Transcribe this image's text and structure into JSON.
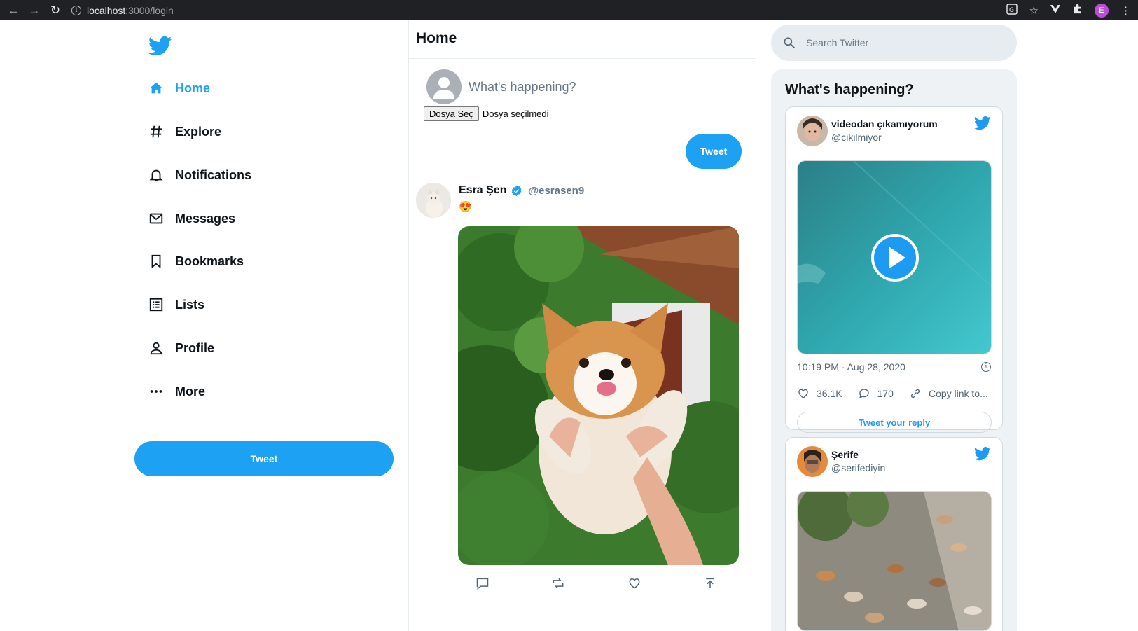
{
  "browser": {
    "url_host": "localhost",
    "url_path": ":3000/login",
    "profile_initial": "E"
  },
  "nav": {
    "items": [
      {
        "label": "Home",
        "icon": "home-icon"
      },
      {
        "label": "Explore",
        "icon": "hashtag-icon"
      },
      {
        "label": "Notifications",
        "icon": "bell-icon"
      },
      {
        "label": "Messages",
        "icon": "mail-icon"
      },
      {
        "label": "Bookmarks",
        "icon": "bookmark-icon"
      },
      {
        "label": "Lists",
        "icon": "list-icon"
      },
      {
        "label": "Profile",
        "icon": "user-icon"
      },
      {
        "label": "More",
        "icon": "more-icon"
      }
    ],
    "tweet_button": "Tweet"
  },
  "feed": {
    "title": "Home",
    "compose_placeholder": "What's happening?",
    "file_button": "Dosya Seç",
    "file_status": "Dosya seçilmedi",
    "tweet_button": "Tweet",
    "post": {
      "name": "Esra Şen",
      "handle": "@esrasen9",
      "text": "😍"
    }
  },
  "sidebar": {
    "search_placeholder": "Search Twitter",
    "trends_title": "What's happening?",
    "embeds": [
      {
        "name": "videodan çıkamıyorum",
        "handle": "@cikilmiyor",
        "time": "10:19 PM · Aug 28, 2020",
        "likes": "36.1K",
        "replies": "170",
        "copy_link": "Copy link to...",
        "reply_button": "Tweet your reply"
      },
      {
        "name": "Şerife",
        "handle": "@serifediyin"
      }
    ]
  },
  "colors": {
    "accent": "#1da1f2",
    "text": "#0f1419",
    "muted": "#657786"
  }
}
